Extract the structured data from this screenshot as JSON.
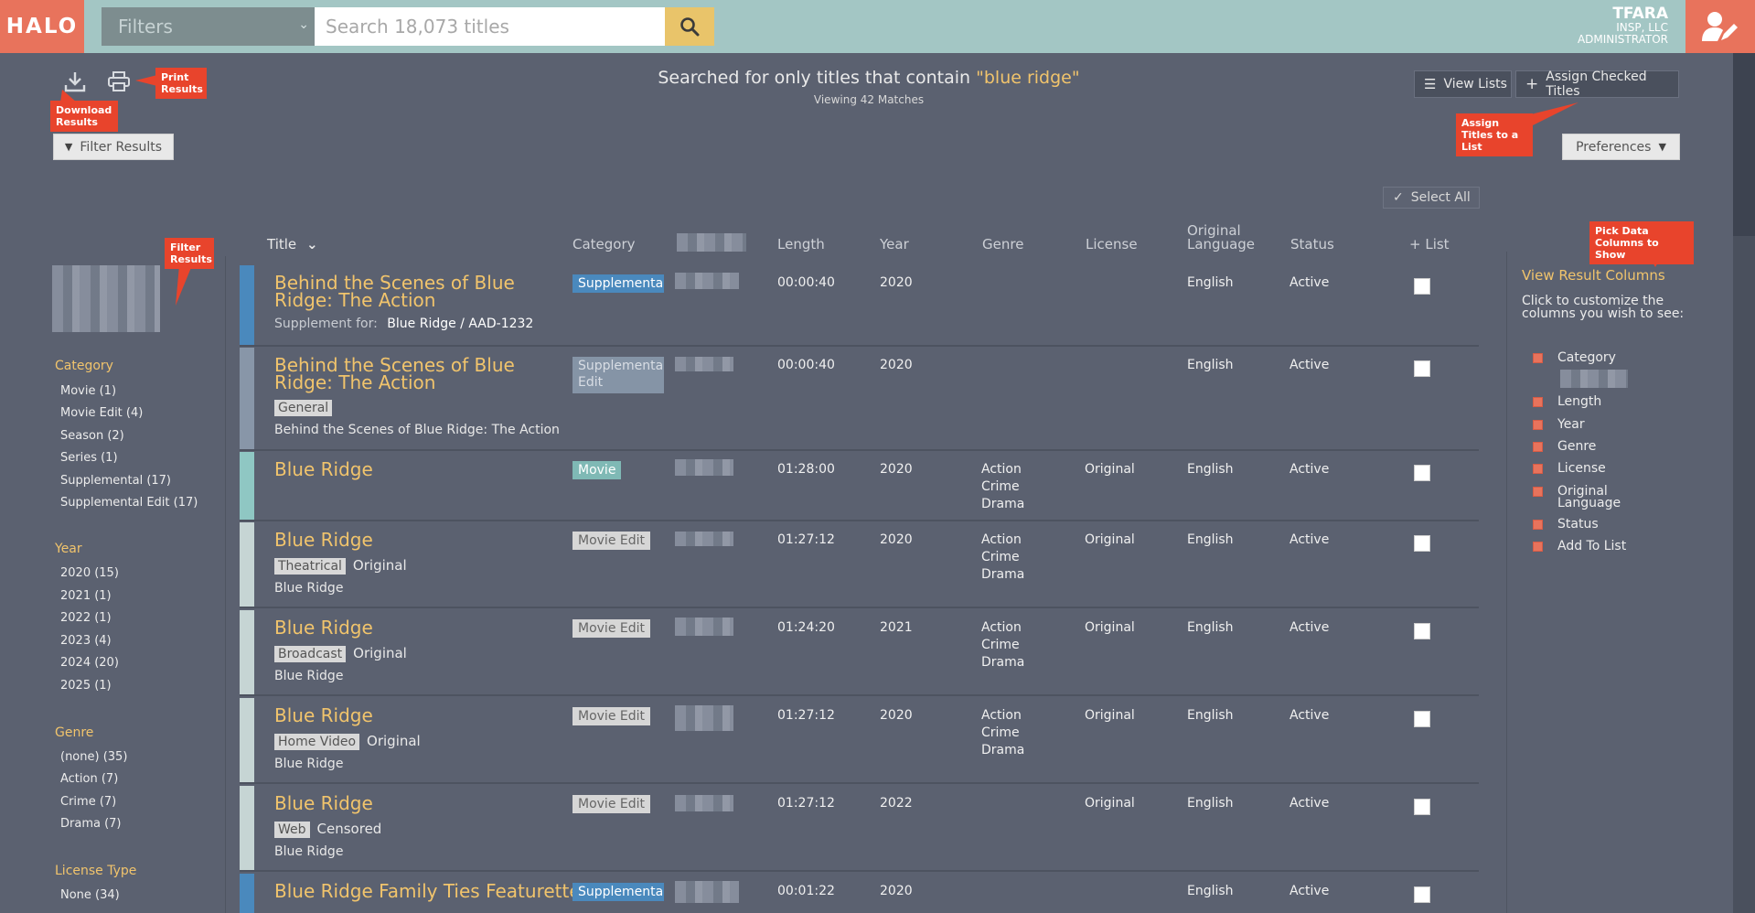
{
  "header": {
    "logo": "HALO",
    "filters_label": "Filters",
    "search_placeholder": "Search 18,073 titles",
    "account_name": "TFARA",
    "account_company": "INSP, LLC",
    "account_role": "ADMINISTRATOR"
  },
  "toolbar": {
    "download_callout": "Download Results",
    "print_callout": "Print Results",
    "filter_results_btn": "Filter Results",
    "view_lists_btn": "View Lists",
    "assign_checked_btn": "Assign Checked Titles",
    "assign_callout": "Assign Titles to a List",
    "preferences_btn": "Preferences",
    "select_all_btn": "Select All"
  },
  "search_summary": {
    "prefix": "Searched for only titles that contain ",
    "query": "\"blue ridge\"",
    "count_text": "Viewing 42 Matches"
  },
  "facets": {
    "filter_callout": "Filter Results",
    "category_title": "Category",
    "category_items": [
      "Movie (1)",
      "Movie Edit (4)",
      "Season (2)",
      "Series (1)",
      "Supplemental (17)",
      "Supplemental Edit (17)"
    ],
    "year_title": "Year",
    "year_items": [
      "2020 (15)",
      "2021 (1)",
      "2022 (1)",
      "2023 (4)",
      "2024 (20)",
      "2025 (1)"
    ],
    "genre_title": "Genre",
    "genre_items": [
      "(none) (35)",
      "Action (7)",
      "Crime (7)",
      "Drama (7)"
    ],
    "license_title": "License Type",
    "license_items": [
      "None (34)"
    ]
  },
  "table": {
    "headers": {
      "title": "Title",
      "category": "Category",
      "length": "Length",
      "year": "Year",
      "genre": "Genre",
      "license": "License",
      "orig_lang": "Original Language",
      "status": "Status",
      "add_list": "+ List"
    },
    "rows": [
      {
        "title": "Behind the Scenes of Blue Ridge: The Action",
        "supp_prefix": "Supplement for:",
        "supp_link": "Blue Ridge / AAD-1232",
        "category": "Supplementa",
        "length": "00:00:40",
        "year": "2020",
        "genre": "",
        "license": "",
        "language": "English",
        "status": "Active"
      },
      {
        "title": "Behind the Scenes of Blue Ridge: The Action",
        "tag": "General",
        "subline": "Behind the Scenes of Blue Ridge: The Action",
        "category": "Supplementa Edit",
        "length": "00:00:40",
        "year": "2020",
        "genre": "",
        "license": "",
        "language": "English",
        "status": "Active"
      },
      {
        "title": "Blue Ridge",
        "category": "Movie",
        "length": "01:28:00",
        "year": "2020",
        "genre": "Action Crime Drama",
        "license": "Original",
        "language": "English",
        "status": "Active"
      },
      {
        "title": "Blue Ridge",
        "tag": "Theatrical",
        "tag_text": "Original",
        "subline": "Blue Ridge",
        "category": "Movie Edit",
        "length": "01:27:12",
        "year": "2020",
        "genre": "Action Crime Drama",
        "license": "Original",
        "language": "English",
        "status": "Active"
      },
      {
        "title": "Blue Ridge",
        "tag": "Broadcast",
        "tag_text": "Original",
        "subline": "Blue Ridge",
        "category": "Movie Edit",
        "length": "01:24:20",
        "year": "2021",
        "genre": "Action Crime Drama",
        "license": "Original",
        "language": "English",
        "status": "Active"
      },
      {
        "title": "Blue Ridge",
        "tag": "Home Video",
        "tag_text": "Original",
        "subline": "Blue Ridge",
        "category": "Movie Edit",
        "length": "01:27:12",
        "year": "2020",
        "genre": "Action Crime Drama",
        "license": "Original",
        "language": "English",
        "status": "Active"
      },
      {
        "title": "Blue Ridge",
        "tag": "Web",
        "tag_text": "Censored",
        "subline": "Blue Ridge",
        "category": "Movie Edit",
        "length": "01:27:12",
        "year": "2022",
        "genre": "",
        "license": "Original",
        "language": "English",
        "status": "Active"
      },
      {
        "title": "Blue Ridge Family Ties Featurette",
        "category": "Supplementa",
        "length": "00:01:22",
        "year": "2020",
        "genre": "",
        "license": "",
        "language": "English",
        "status": "Active"
      }
    ]
  },
  "right_panel": {
    "callout": "Pick Data Columns to Show",
    "title": "View Result Columns",
    "description": "Click to customize the columns you wish to see:",
    "items": [
      "Category",
      "Length",
      "Year",
      "Genre",
      "License",
      "Original Language",
      "Status",
      "Add To List"
    ]
  },
  "colors": {
    "header_bg": "#a3c6c4",
    "brand": "#e8735c",
    "accent": "#f1c46c",
    "callout": "#e8442c",
    "background": "#5b6170"
  }
}
